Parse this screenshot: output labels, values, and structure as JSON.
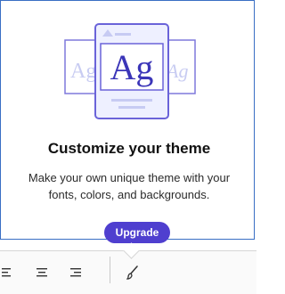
{
  "illustration": {
    "sample_text": "Ag"
  },
  "popover": {
    "title": "Customize your theme",
    "description": "Make your own unique theme with your fonts, colors, and backgrounds.",
    "upgrade_label": "Upgrade"
  },
  "colors": {
    "accent": "#4f3fcf",
    "card_bg": "#eef0ff",
    "card_border": "#6a63d9",
    "popover_border": "#3a6fc4"
  },
  "toolbar": {
    "icons": [
      "align-left-icon",
      "align-center-icon",
      "align-right-icon",
      "brush-icon"
    ]
  }
}
